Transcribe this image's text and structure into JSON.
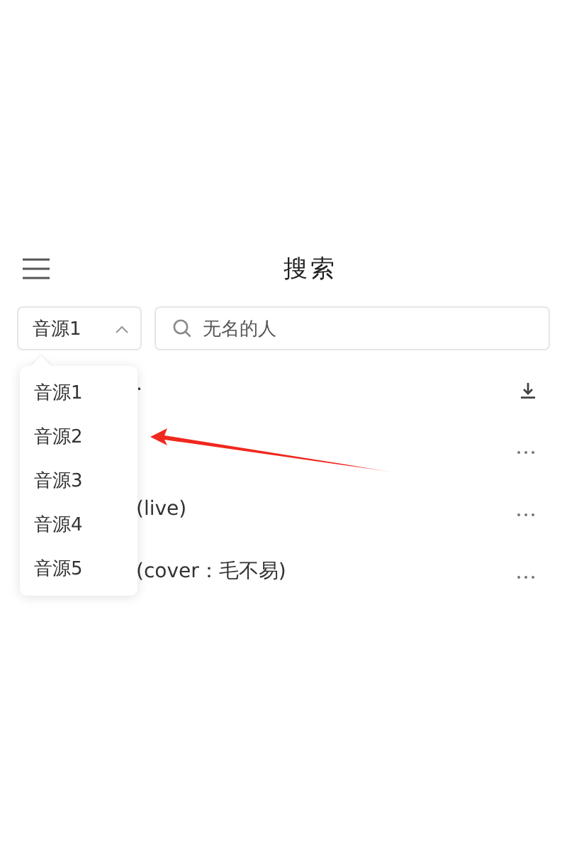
{
  "header": {
    "title": "搜索"
  },
  "source_select": {
    "value": "音源1",
    "expanded": true
  },
  "search": {
    "value": "无名的人"
  },
  "source_menu": [
    {
      "label": "音源1",
      "selected": false
    },
    {
      "label": "音源2",
      "selected": false
    },
    {
      "label": "音源3",
      "selected": false
    },
    {
      "label": "音源4",
      "selected": false
    },
    {
      "label": "音源5",
      "selected": false
    }
  ],
  "results": [
    {
      "title": ".",
      "kind": "download"
    },
    {
      "kind": "more"
    },
    {
      "title": "(live)",
      "kind": "more"
    },
    {
      "title": "(cover：毛不易)",
      "kind": "more"
    }
  ]
}
